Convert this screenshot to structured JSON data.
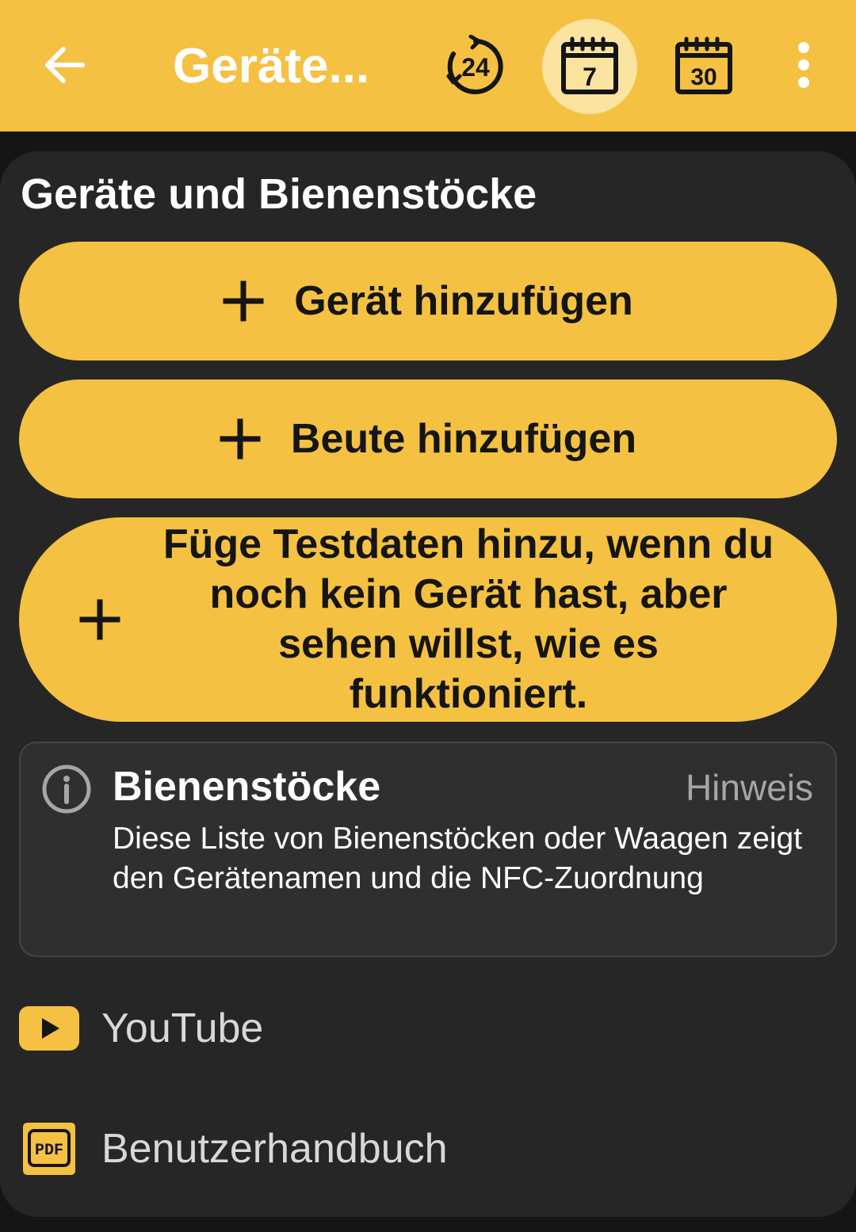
{
  "appbar": {
    "title": "Geräte...",
    "range_24_label": "24",
    "range_7_label": "7",
    "range_30_label": "30",
    "active_range": "7",
    "background": "#F4C142"
  },
  "section": {
    "title": "Geräte und Bienenstöcke"
  },
  "actions": {
    "add_device": "Gerät hinzufügen",
    "add_loot": "Beute hinzufügen",
    "add_test_data": "Füge Testdaten hinzu, wenn du noch kein Gerät hast, aber sehen willst, wie es funktioniert."
  },
  "info_card": {
    "title": "Bienenstöcke",
    "hint": "Hinweis",
    "body": "Diese Liste von Bienenstöcken oder Waagen zeigt den Gerätenamen und die NFC-Zuordnung"
  },
  "links": {
    "youtube": "YouTube",
    "manual": "Benutzerhandbuch",
    "pdf_badge": "PDF"
  },
  "colors": {
    "accent": "#F4C142",
    "accent_light": "#FBE3A0",
    "sheet": "#262626",
    "card": "#2F2F2F"
  }
}
